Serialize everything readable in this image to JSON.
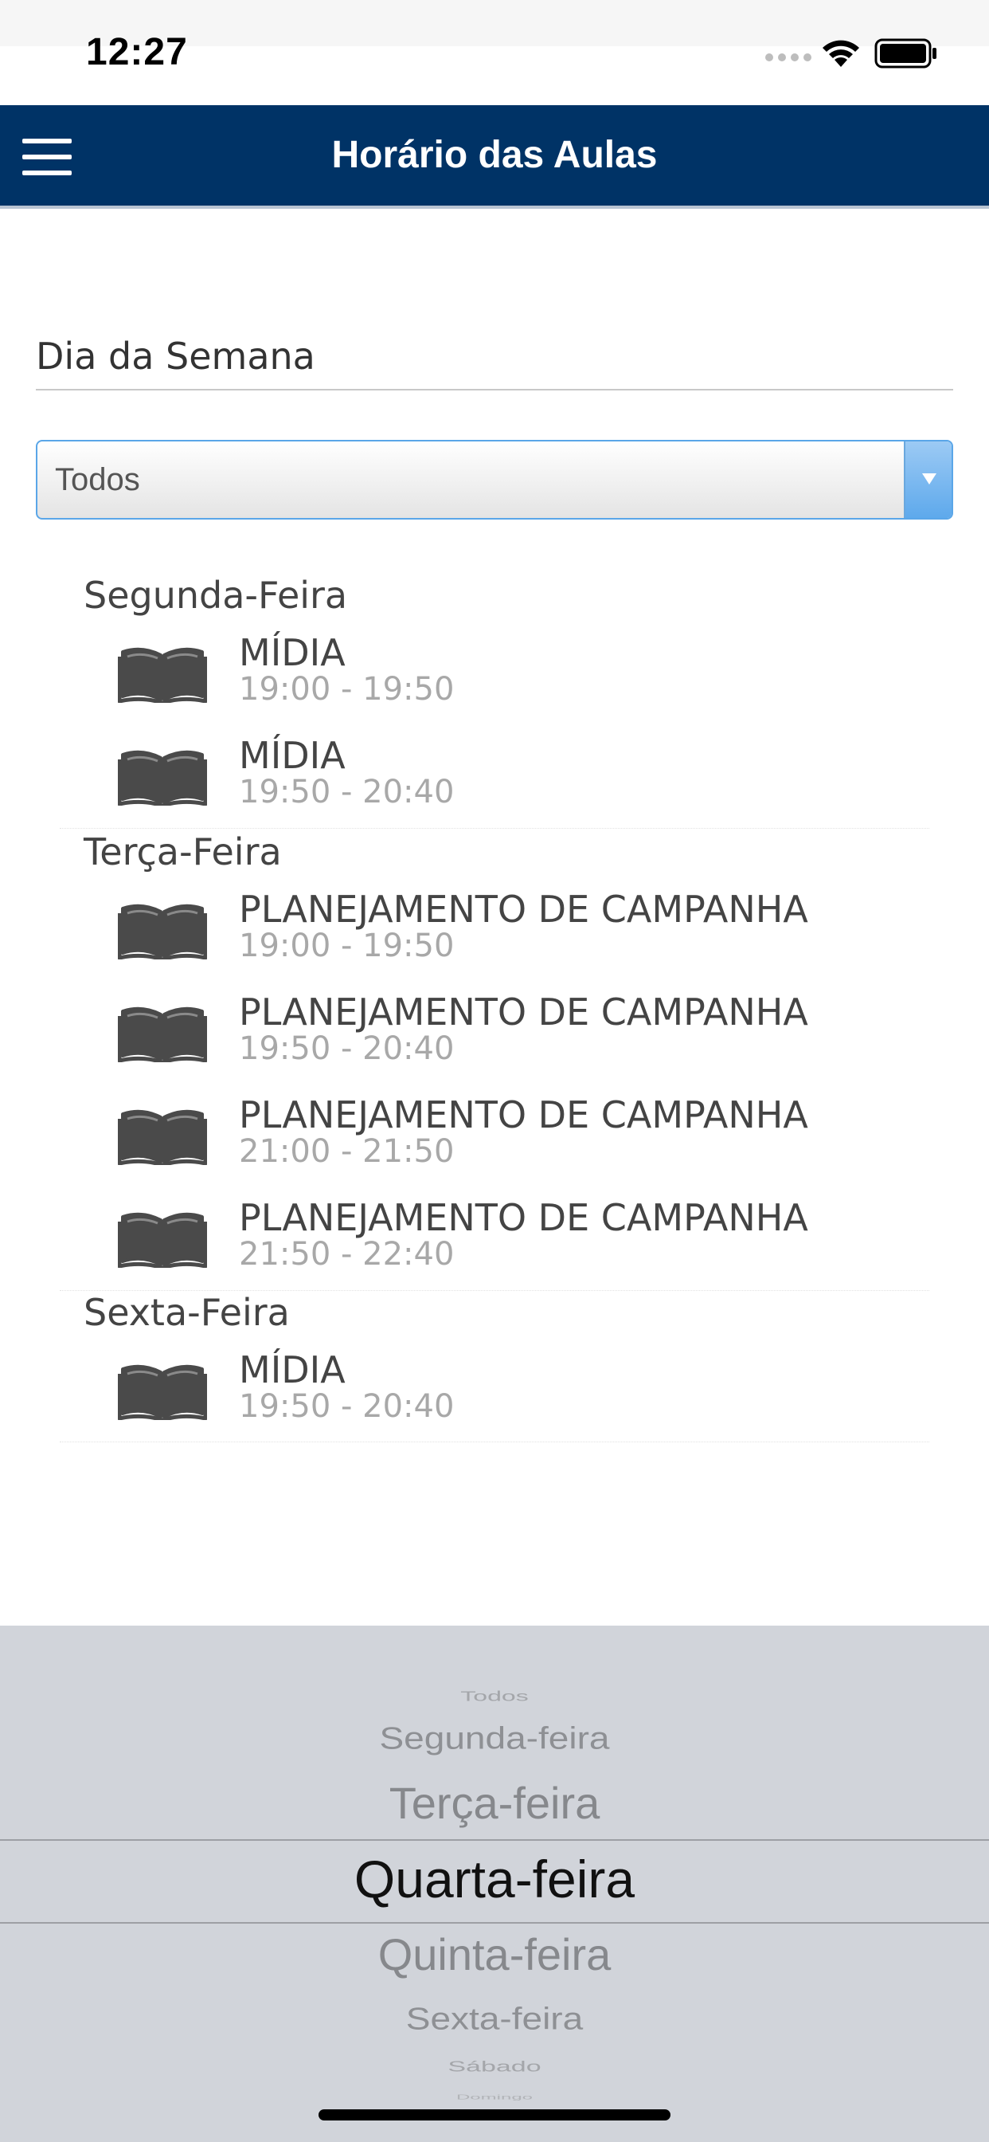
{
  "status_bar": {
    "time": "12:27"
  },
  "header": {
    "title": "Horário das Aulas",
    "menu_icon": "hamburger-menu-icon"
  },
  "filter": {
    "label": "Dia da Semana",
    "selected": "Todos"
  },
  "schedule": [
    {
      "day": "Segunda-Feira",
      "classes": [
        {
          "name": "MÍDIA",
          "time": "19:00 - 19:50"
        },
        {
          "name": "MÍDIA",
          "time": "19:50 - 20:40"
        }
      ]
    },
    {
      "day": "Terça-Feira",
      "classes": [
        {
          "name": "PLANEJAMENTO DE CAMPANHA",
          "time": "19:00 - 19:50"
        },
        {
          "name": "PLANEJAMENTO DE CAMPANHA",
          "time": "19:50 - 20:40"
        },
        {
          "name": "PLANEJAMENTO DE CAMPANHA",
          "time": "21:00 - 21:50"
        },
        {
          "name": "PLANEJAMENTO DE CAMPANHA",
          "time": "21:50 - 22:40"
        }
      ]
    },
    {
      "day": "Sexta-Feira",
      "classes": [
        {
          "name": "MÍDIA",
          "time": "19:50 - 20:40"
        }
      ]
    }
  ],
  "picker": {
    "options": [
      "Todos",
      "Segunda-feira",
      "Terça-feira",
      "Quarta-feira",
      "Quinta-feira",
      "Sexta-feira",
      "Sábado",
      "Domingo"
    ],
    "selected": "Quarta-feira"
  },
  "colors": {
    "header_bg": "#003366",
    "select_border": "#5aa6e8",
    "picker_bg": "#d1d4da"
  }
}
